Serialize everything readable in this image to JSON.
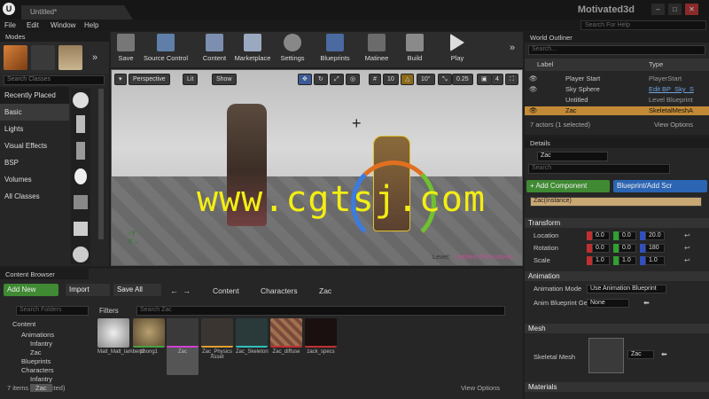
{
  "title": {
    "doc_tab": "Untitled*",
    "brand": "Motivated3d",
    "search_help": "Search For Help"
  },
  "menu": [
    "File",
    "Edit",
    "Window",
    "Help"
  ],
  "modes": {
    "tab": "Modes",
    "search": "Search Classes",
    "items": [
      "Recently Placed",
      "Basic",
      "Lights",
      "Visual Effects",
      "BSP",
      "Volumes",
      "All Classes"
    ]
  },
  "toolbar": [
    "Save",
    "Source Control",
    "Content",
    "Marketplace",
    "Settings",
    "Blueprints",
    "Matinee",
    "Build",
    "Play"
  ],
  "viewport": {
    "perspective": "Perspective",
    "lit": "Lit",
    "show": "Show",
    "grid": "10",
    "angle": "10°",
    "scale": "0.25",
    "cam": "4",
    "level_label": "Level:",
    "level_name": "Untitled (Persistent)",
    "watermark": "www.cgtsj.com"
  },
  "outliner": {
    "tab": "World Outliner",
    "search": "Search...",
    "col_label": "Label",
    "col_type": "Type",
    "rows": [
      {
        "label": "Player Start",
        "type": "PlayerStart"
      },
      {
        "label": "Sky Sphere",
        "type": "Edit BP_Sky_S"
      },
      {
        "label": "Untitled",
        "type": "Level Blueprint"
      },
      {
        "label": "Zac",
        "type": "SkeletalMeshA"
      }
    ],
    "status": "7 actors (1 selected)",
    "view": "View Options"
  },
  "details": {
    "tab": "Details",
    "name": "Zac",
    "search": "Search",
    "add": "+ Add Component",
    "bp": "Blueprint/Add Scr",
    "instance": "Zac(Instance)",
    "transform": "Transform",
    "location": "Location",
    "rotation": "Rotation",
    "scale": "Scale",
    "loc": [
      "0.0",
      "0.0",
      "20.0"
    ],
    "rot": [
      "0.0",
      "0.0",
      "180"
    ],
    "scl": [
      "1.0",
      "1.0",
      "1.0"
    ],
    "animation": "Animation",
    "anim_mode_label": "Animation Mode",
    "anim_mode": "Use Animation Blueprint",
    "anim_bp_label": "Anim Blueprint Ge",
    "anim_bp": "None",
    "mesh": "Mesh",
    "skeletal_label": "Skeletal Mesh",
    "skeletal": "Zac",
    "materials": "Materials"
  },
  "content_browser": {
    "tab": "Content Browser",
    "add_new": "Add New",
    "import": "Import",
    "save_all": "Save All",
    "path": [
      "Content",
      "Characters",
      "Zac"
    ],
    "search_folders": "Search Folders",
    "filters": "Filters",
    "search_zac": "Search Zac",
    "tree": [
      "Content",
      "Animations",
      "Infantry",
      "Zac",
      "Blueprints",
      "Characters",
      "Infantry",
      "Zac"
    ],
    "assets": [
      "Matt_Matt_lambert2",
      "phong1",
      "Zac",
      "Zac_Physics Asset",
      "Zac_Skeleton",
      "Zac_diffuse",
      "zack_specs"
    ],
    "status": "7 items (1 selected)",
    "view": "View Options"
  }
}
